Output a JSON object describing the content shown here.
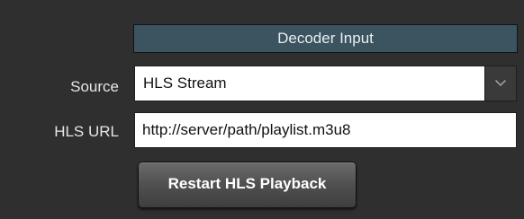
{
  "section": {
    "title": "Decoder Input"
  },
  "source": {
    "label": "Source",
    "selected": "HLS Stream"
  },
  "hls_url": {
    "label": "HLS URL",
    "value": "http://server/path/playlist.m3u8"
  },
  "actions": {
    "restart_label": "Restart HLS Playback"
  },
  "icons": {
    "dropdown": "chevron-down-icon"
  },
  "colors": {
    "background": "#2f2f2f",
    "header": "#3c5460",
    "button": "#525252"
  }
}
